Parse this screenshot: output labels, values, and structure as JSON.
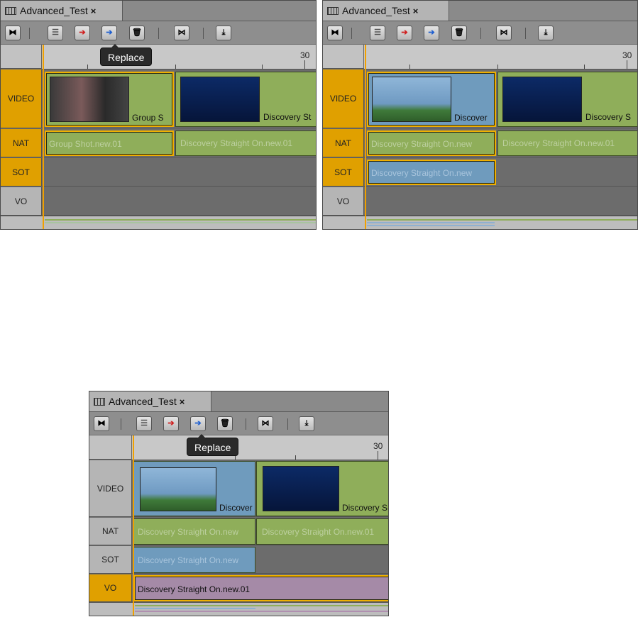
{
  "tab": {
    "label": "Advanced_Test",
    "close": "×"
  },
  "tooltip": "Replace",
  "ruler_label": "30",
  "tracks": {
    "video": "VIDEO",
    "nat": "NAT",
    "sot": "SOT",
    "vo": "VO"
  },
  "panel1": {
    "video_clips": [
      "Group S",
      "Discovery St"
    ],
    "nat_clips": [
      "Group Shot.new.01",
      "Discovery Straight On.new.01"
    ]
  },
  "panel2": {
    "video_clips": [
      "Discover",
      "Discovery S"
    ],
    "nat_clips": [
      "Discovery Straight On.new",
      "Discovery Straight On.new.01"
    ],
    "sot_clips": [
      "Discovery Straight On.new"
    ]
  },
  "panel3": {
    "video_clips": [
      "Discover",
      "Discovery S"
    ],
    "nat_clips": [
      "Discovery Straight On.new",
      "Discovery Straight On.new.01"
    ],
    "sot_clips": [
      "Discovery Straight On.new"
    ],
    "vo_clips": [
      "Discovery Straight On.new.01"
    ]
  },
  "colors": {
    "active_track": "#e0a000",
    "selection": "#f0b000",
    "clip_green": "#8fae5a",
    "clip_blue": "#6f9bbd",
    "clip_purple": "#a58aa7"
  }
}
